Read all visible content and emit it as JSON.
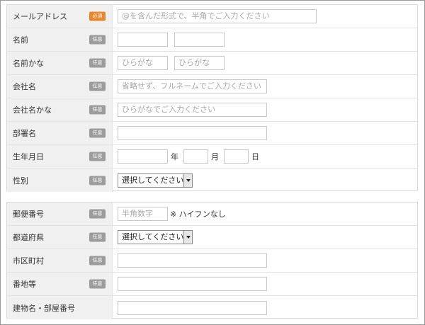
{
  "section1": {
    "rows": [
      {
        "label": "メールアドレス",
        "badge": "必須",
        "placeholder": "@を含んだ形式で、半角でご入力ください"
      },
      {
        "label": "名前",
        "badge": "任意",
        "placeholder_a": "",
        "placeholder_b": ""
      },
      {
        "label": "名前かな",
        "badge": "任意",
        "placeholder_a": "ひらがな",
        "placeholder_b": "ひらがな"
      },
      {
        "label": "会社名",
        "badge": "任意",
        "placeholder": "省略せず、フルネームでご入力ください"
      },
      {
        "label": "会社名かな",
        "badge": "任意",
        "placeholder": "ひらがなでご入力ください"
      },
      {
        "label": "部署名",
        "badge": "任意",
        "placeholder": ""
      },
      {
        "label": "生年月日",
        "badge": "任意",
        "unit_year": "年",
        "unit_month": "月",
        "unit_day": "日"
      },
      {
        "label": "性別",
        "badge": "任意",
        "select_value": "選択してください"
      }
    ]
  },
  "section2": {
    "rows": [
      {
        "label": "郵便番号",
        "badge": "任意",
        "placeholder": "半角数字",
        "note": "※ ハイフンなし"
      },
      {
        "label": "都道府県",
        "badge": "任意",
        "select_value": "選択してください"
      },
      {
        "label": "市区町村",
        "badge": "任意",
        "placeholder": ""
      },
      {
        "label": "番地等",
        "badge": "任意",
        "placeholder": ""
      },
      {
        "label": "建物名・部屋番号",
        "badge": "",
        "placeholder": ""
      }
    ]
  }
}
